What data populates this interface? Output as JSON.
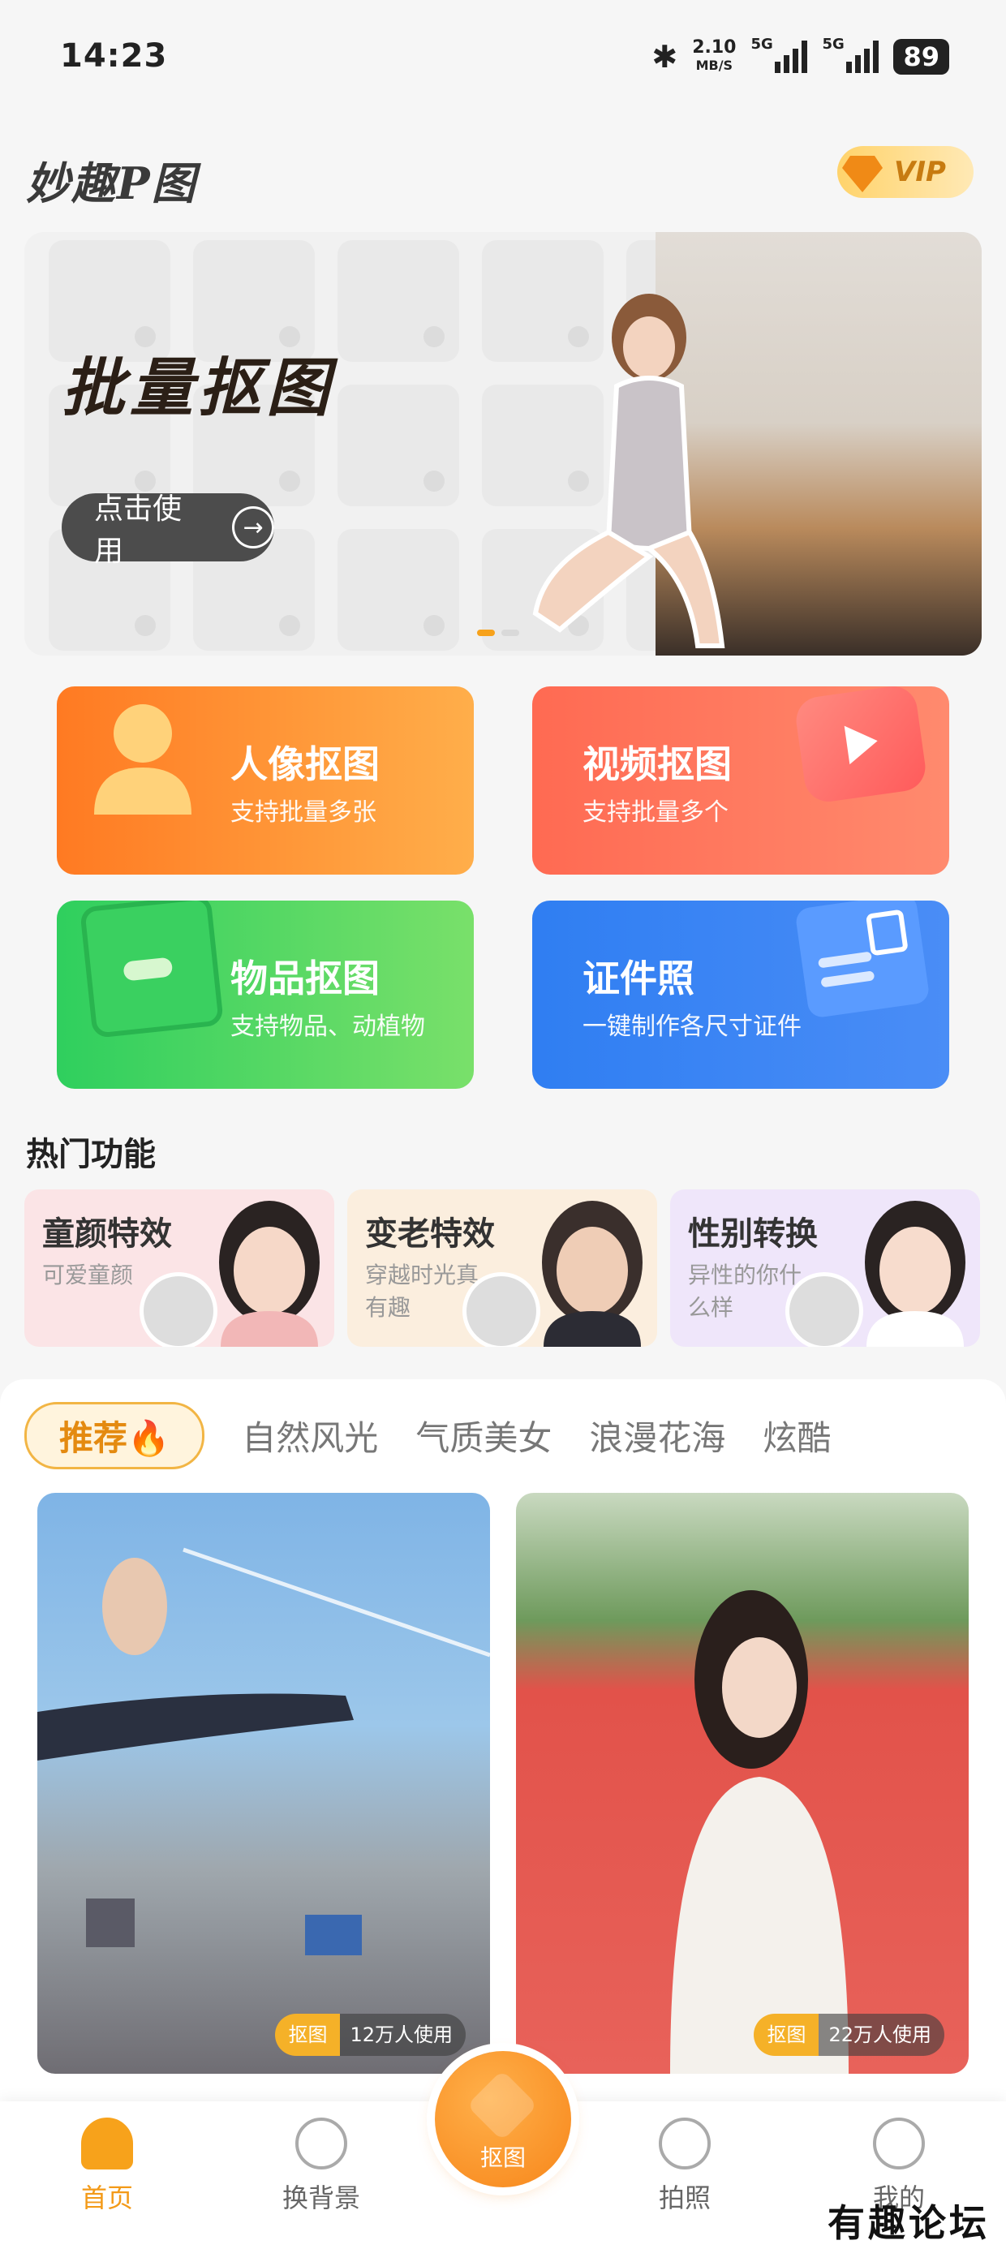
{
  "status_bar": {
    "time": "14:23",
    "net_speed": "2.10",
    "net_unit": "MB/S",
    "sig1": "5G",
    "sig2": "5G",
    "battery": "89"
  },
  "header": {
    "app_name": "妙趣P图",
    "vip_label": "VIP"
  },
  "banner": {
    "title": "批量抠图",
    "button": "点击使用"
  },
  "features": [
    {
      "title": "人像抠图",
      "subtitle": "支持批量多张"
    },
    {
      "title": "视频抠图",
      "subtitle": "支持批量多个"
    },
    {
      "title": "物品抠图",
      "subtitle": "支持物品、动植物"
    },
    {
      "title": "证件照",
      "subtitle": "一键制作各尺寸证件"
    }
  ],
  "hot": {
    "title": "热门功能",
    "items": [
      {
        "title": "童颜特效",
        "desc": "可爱童颜"
      },
      {
        "title": "变老特效",
        "desc": "穿越时光真有趣"
      },
      {
        "title": "性别转换",
        "desc": "异性的你什么样"
      }
    ]
  },
  "tabs": [
    "推荐🔥",
    "自然风光",
    "气质美女",
    "浪漫花海",
    "炫酷"
  ],
  "cards": [
    {
      "tag": "抠图",
      "users": "12万人使用"
    },
    {
      "tag": "抠图",
      "users": "22万人使用"
    }
  ],
  "nav": {
    "home": "首页",
    "bg": "换背景",
    "cutout": "抠图",
    "photo": "拍照",
    "mine": "我的"
  },
  "watermark": "有趣论坛"
}
